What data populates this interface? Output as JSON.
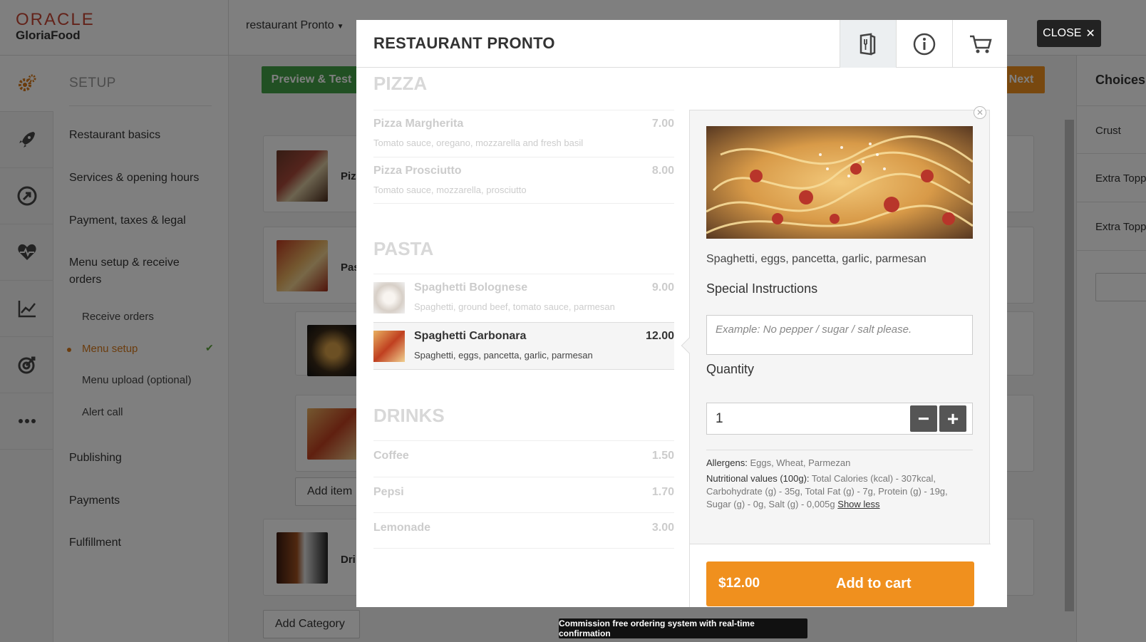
{
  "app": {
    "logo_line1": "ORACLE",
    "logo_line2": "GloriaFood",
    "restaurant_select": "restaurant Pronto"
  },
  "sidebar": {
    "title": "SETUP",
    "items": [
      {
        "label": "Restaurant basics"
      },
      {
        "label": "Services & opening hours"
      },
      {
        "label": "Payment, taxes & legal"
      },
      {
        "label": "Menu setup & receive orders"
      },
      {
        "label": "Publishing"
      },
      {
        "label": "Payments"
      },
      {
        "label": "Fulfillment"
      }
    ],
    "subitems": [
      {
        "label": "Receive orders"
      },
      {
        "label": "Menu setup"
      },
      {
        "label": "Menu upload (optional)"
      },
      {
        "label": "Alert call"
      }
    ]
  },
  "rail_icons": [
    "gears-icon",
    "rocket-icon",
    "share-icon",
    "heart-pulse-icon",
    "chart-icon",
    "target-icon",
    "more-icon"
  ],
  "background": {
    "preview_label": "Preview & Test",
    "next_label": "Next",
    "cards": [
      {
        "label": "Pizz"
      },
      {
        "label": "Pas"
      },
      {
        "label": "Dri"
      }
    ],
    "add_item_label": "Add item",
    "add_category_label": "Add Category",
    "right_panel": {
      "title": "Choices",
      "items": [
        {
          "label": "Crust"
        },
        {
          "label": "Extra Topp"
        },
        {
          "label": "Extra Topp"
        }
      ]
    }
  },
  "modal": {
    "title": "RESTAURANT PRONTO",
    "tabs": [
      "menu-icon",
      "info-icon",
      "cart-icon"
    ],
    "categories": [
      {
        "name": "PIZZA",
        "items": [
          {
            "name": "Pizza Margherita",
            "desc": "Tomato sauce, oregano, mozzarella and fresh basil",
            "price": "7.00"
          },
          {
            "name": "Pizza Prosciutto",
            "desc": "Tomato sauce, mozzarella, prosciutto",
            "price": "8.00"
          }
        ]
      },
      {
        "name": "PASTA",
        "items": [
          {
            "name": "Spaghetti Bolognese",
            "desc": "Spaghetti, ground beef, tomato sauce, parmesan",
            "price": "9.00"
          },
          {
            "name": "Spaghetti Carbonara",
            "desc": "Spaghetti, eggs, pancetta, garlic, parmesan",
            "price": "12.00"
          }
        ]
      },
      {
        "name": "DRINKS",
        "items": [
          {
            "name": "Coffee",
            "price": "1.50"
          },
          {
            "name": "Pepsi",
            "price": "1.70"
          },
          {
            "name": "Lemonade",
            "price": "3.00"
          }
        ]
      }
    ],
    "detail": {
      "description": "Spaghetti, eggs, pancetta, garlic, parmesan",
      "special_label": "Special Instructions",
      "special_placeholder": "Example: No pepper / sugar / salt please.",
      "quantity_label": "Quantity",
      "quantity_value": "1",
      "allergens_label": "Allergens:",
      "allergens_value": "Eggs, Wheat, Parmezan",
      "nutrition_label": "Nutritional values (100g):",
      "nutrition_value": "Total Calories (kcal) - 307kcal, Carbohydrate (g) - 35g, Total Fat (g) - 7g, Protein (g) - 19g, Sugar (g) - 0g, Salt (g) - 0,005g",
      "show_less": "Show less",
      "cart_price": "$12.00",
      "add_to_cart": "Add to cart"
    }
  },
  "close_label": "CLOSE",
  "tooltip": "Commission free ordering system with real-time confirmation",
  "colors": {
    "accent": "#f0901e",
    "brand_red": "#c74634",
    "green": "#43a047",
    "active_menu": "#d7791a"
  }
}
